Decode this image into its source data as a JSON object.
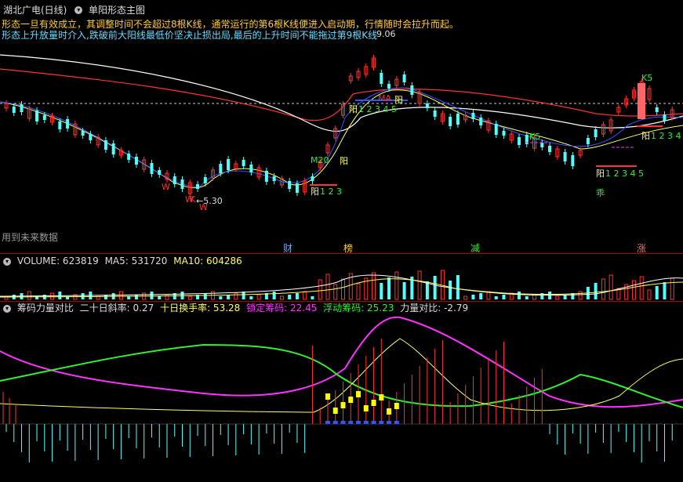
{
  "window": {
    "stock_title": "湖北广电(日线)",
    "indicator_name": "单阳形态主图"
  },
  "notes": {
    "line1": "形态一旦有效成立，其调整时间不会超过8根K线，通常运行的第6根K线便进入启动期，行情随时会拉升而起。",
    "line2": "形态上升放量时介入,跌破前大阳线最低价坚决止损出局,最后的上升时间不能拖过第9根K线"
  },
  "price_labels": {
    "high": "9.06",
    "low": "5.30"
  },
  "markers": {
    "w_label": "W",
    "k_label": "K",
    "k5_label": "K5",
    "m20_label": "M20",
    "ma_label": "MA",
    "yang_label": "阳",
    "guai_label": "乖",
    "count_label_a": "1 2 3",
    "count_label_b": "1 2 3 4 5",
    "arrow_left": "←"
  },
  "bottom_strip": {
    "future_data": "用到未来数据",
    "tags": [
      "财",
      "榜",
      "减",
      "涨"
    ]
  },
  "volume_panel": {
    "label": "VOLUME: 623819",
    "ma5": "MA5: 531720",
    "ma10": "MA10: 604286"
  },
  "chips_panel": {
    "title": "筹码力量对比",
    "slope": "二十日斜率: 0.27",
    "turnover": "十日换手率: 53.28",
    "locked": "锁定筹码: 22.45",
    "floating": "浮动筹码: 25.23",
    "power": "力量对比: -2.79"
  },
  "colors": {
    "up": "#ff3333",
    "down": "#54ffff",
    "ma_white": "#ffffff",
    "ma_yellow": "#ffff66",
    "ma_blue": "#3355ff",
    "magenta": "#ff33ff",
    "green": "#33ee33",
    "orange_text": "#ffcc33",
    "cyan_text": "#66ddff"
  }
}
